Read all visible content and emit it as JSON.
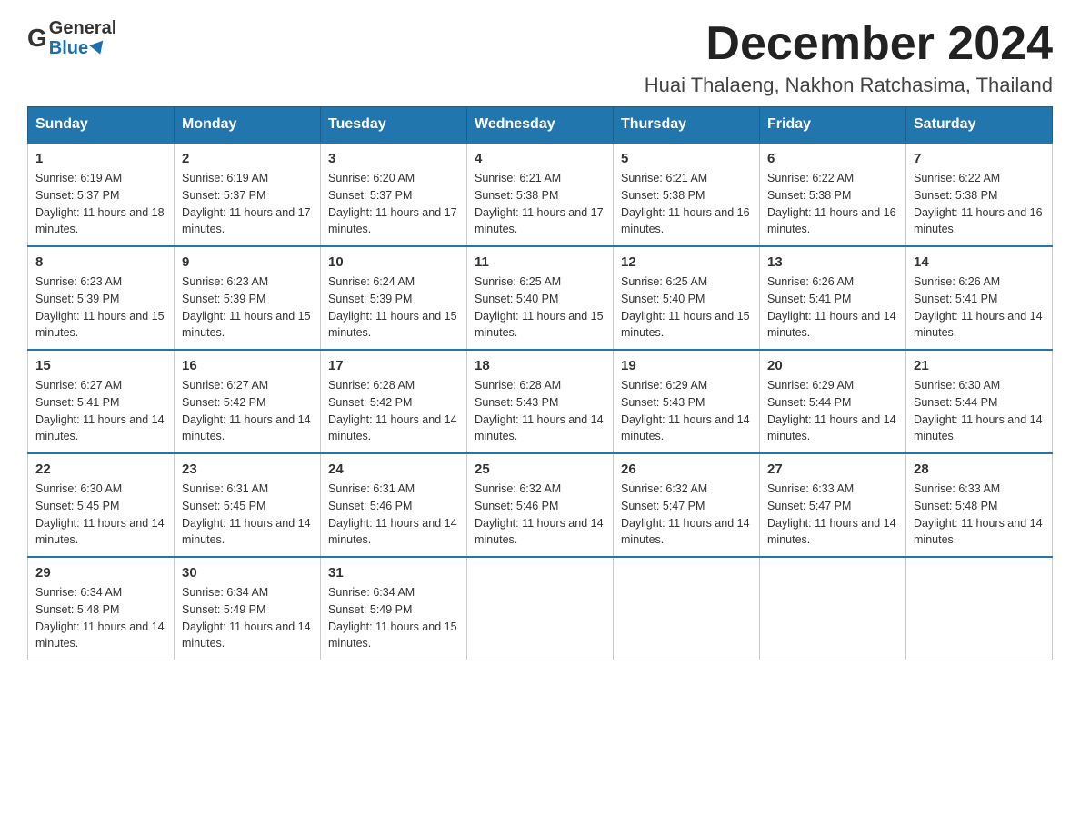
{
  "header": {
    "logo_general": "General",
    "logo_blue": "Blue",
    "month_title": "December 2024",
    "location": "Huai Thalaeng, Nakhon Ratchasima, Thailand"
  },
  "days_of_week": [
    "Sunday",
    "Monday",
    "Tuesday",
    "Wednesday",
    "Thursday",
    "Friday",
    "Saturday"
  ],
  "weeks": [
    [
      {
        "day": "1",
        "sunrise": "6:19 AM",
        "sunset": "5:37 PM",
        "daylight": "11 hours and 18 minutes."
      },
      {
        "day": "2",
        "sunrise": "6:19 AM",
        "sunset": "5:37 PM",
        "daylight": "11 hours and 17 minutes."
      },
      {
        "day": "3",
        "sunrise": "6:20 AM",
        "sunset": "5:37 PM",
        "daylight": "11 hours and 17 minutes."
      },
      {
        "day": "4",
        "sunrise": "6:21 AM",
        "sunset": "5:38 PM",
        "daylight": "11 hours and 17 minutes."
      },
      {
        "day": "5",
        "sunrise": "6:21 AM",
        "sunset": "5:38 PM",
        "daylight": "11 hours and 16 minutes."
      },
      {
        "day": "6",
        "sunrise": "6:22 AM",
        "sunset": "5:38 PM",
        "daylight": "11 hours and 16 minutes."
      },
      {
        "day": "7",
        "sunrise": "6:22 AM",
        "sunset": "5:38 PM",
        "daylight": "11 hours and 16 minutes."
      }
    ],
    [
      {
        "day": "8",
        "sunrise": "6:23 AM",
        "sunset": "5:39 PM",
        "daylight": "11 hours and 15 minutes."
      },
      {
        "day": "9",
        "sunrise": "6:23 AM",
        "sunset": "5:39 PM",
        "daylight": "11 hours and 15 minutes."
      },
      {
        "day": "10",
        "sunrise": "6:24 AM",
        "sunset": "5:39 PM",
        "daylight": "11 hours and 15 minutes."
      },
      {
        "day": "11",
        "sunrise": "6:25 AM",
        "sunset": "5:40 PM",
        "daylight": "11 hours and 15 minutes."
      },
      {
        "day": "12",
        "sunrise": "6:25 AM",
        "sunset": "5:40 PM",
        "daylight": "11 hours and 15 minutes."
      },
      {
        "day": "13",
        "sunrise": "6:26 AM",
        "sunset": "5:41 PM",
        "daylight": "11 hours and 14 minutes."
      },
      {
        "day": "14",
        "sunrise": "6:26 AM",
        "sunset": "5:41 PM",
        "daylight": "11 hours and 14 minutes."
      }
    ],
    [
      {
        "day": "15",
        "sunrise": "6:27 AM",
        "sunset": "5:41 PM",
        "daylight": "11 hours and 14 minutes."
      },
      {
        "day": "16",
        "sunrise": "6:27 AM",
        "sunset": "5:42 PM",
        "daylight": "11 hours and 14 minutes."
      },
      {
        "day": "17",
        "sunrise": "6:28 AM",
        "sunset": "5:42 PM",
        "daylight": "11 hours and 14 minutes."
      },
      {
        "day": "18",
        "sunrise": "6:28 AM",
        "sunset": "5:43 PM",
        "daylight": "11 hours and 14 minutes."
      },
      {
        "day": "19",
        "sunrise": "6:29 AM",
        "sunset": "5:43 PM",
        "daylight": "11 hours and 14 minutes."
      },
      {
        "day": "20",
        "sunrise": "6:29 AM",
        "sunset": "5:44 PM",
        "daylight": "11 hours and 14 minutes."
      },
      {
        "day": "21",
        "sunrise": "6:30 AM",
        "sunset": "5:44 PM",
        "daylight": "11 hours and 14 minutes."
      }
    ],
    [
      {
        "day": "22",
        "sunrise": "6:30 AM",
        "sunset": "5:45 PM",
        "daylight": "11 hours and 14 minutes."
      },
      {
        "day": "23",
        "sunrise": "6:31 AM",
        "sunset": "5:45 PM",
        "daylight": "11 hours and 14 minutes."
      },
      {
        "day": "24",
        "sunrise": "6:31 AM",
        "sunset": "5:46 PM",
        "daylight": "11 hours and 14 minutes."
      },
      {
        "day": "25",
        "sunrise": "6:32 AM",
        "sunset": "5:46 PM",
        "daylight": "11 hours and 14 minutes."
      },
      {
        "day": "26",
        "sunrise": "6:32 AM",
        "sunset": "5:47 PM",
        "daylight": "11 hours and 14 minutes."
      },
      {
        "day": "27",
        "sunrise": "6:33 AM",
        "sunset": "5:47 PM",
        "daylight": "11 hours and 14 minutes."
      },
      {
        "day": "28",
        "sunrise": "6:33 AM",
        "sunset": "5:48 PM",
        "daylight": "11 hours and 14 minutes."
      }
    ],
    [
      {
        "day": "29",
        "sunrise": "6:34 AM",
        "sunset": "5:48 PM",
        "daylight": "11 hours and 14 minutes."
      },
      {
        "day": "30",
        "sunrise": "6:34 AM",
        "sunset": "5:49 PM",
        "daylight": "11 hours and 14 minutes."
      },
      {
        "day": "31",
        "sunrise": "6:34 AM",
        "sunset": "5:49 PM",
        "daylight": "11 hours and 15 minutes."
      },
      null,
      null,
      null,
      null
    ]
  ]
}
